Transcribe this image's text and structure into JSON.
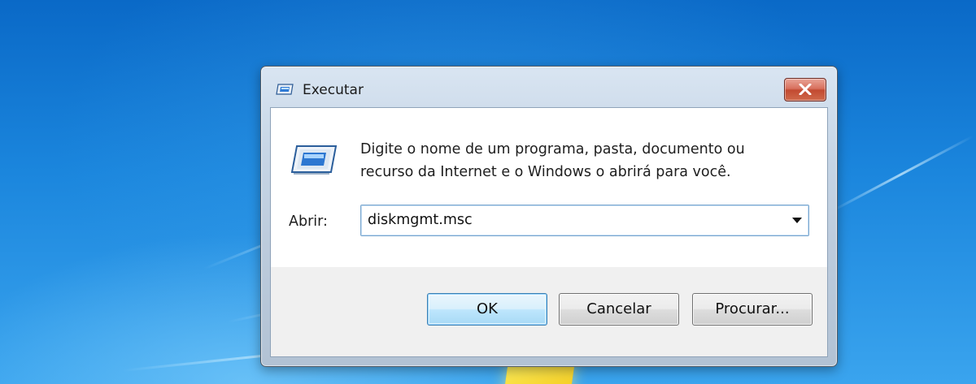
{
  "window": {
    "title": "Executar"
  },
  "dialog": {
    "description_line1": "Digite o nome de um programa, pasta, documento ou",
    "description_line2": "recurso da Internet e o Windows o abrirá para você.",
    "open_label": "Abrir:",
    "command_value": "diskmgmt.msc"
  },
  "buttons": {
    "ok": "OK",
    "cancel": "Cancelar",
    "browse": "Procurar..."
  },
  "icons": {
    "title": "run-icon",
    "close": "close-icon",
    "dropdown": "chevron-down-icon"
  },
  "colors": {
    "desktop": "#1b86dd",
    "close_button": "#c24a31",
    "default_button": "#bee6fd"
  }
}
